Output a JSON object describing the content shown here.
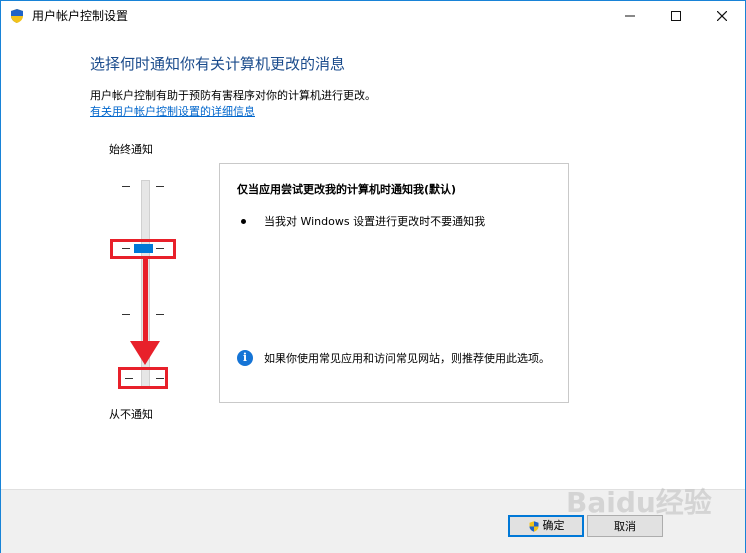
{
  "window": {
    "title": "用户帐户控制设置"
  },
  "main": {
    "heading": "选择何时通知你有关计算机更改的消息",
    "description": "用户帐户控制有助于预防有害程序对你的计算机进行更改。",
    "more_link": "有关用户帐户控制设置的详细信息"
  },
  "slider": {
    "label_top": "始终通知",
    "label_bottom": "从不通知",
    "level": 2,
    "levels_total": 4
  },
  "panel": {
    "title": "仅当应用尝试更改我的计算机时通知我(默认)",
    "bullet": "当我对 Windows 设置进行更改时不要通知我",
    "info": "如果你使用常见应用和访问常见网站，则推荐使用此选项。"
  },
  "footer": {
    "ok_label": "确定",
    "cancel_label": "取消"
  },
  "colors": {
    "accent": "#0078d7",
    "heading": "#1a4b8c",
    "annotation_red": "#e8202a"
  },
  "watermark": "Baidu经验"
}
